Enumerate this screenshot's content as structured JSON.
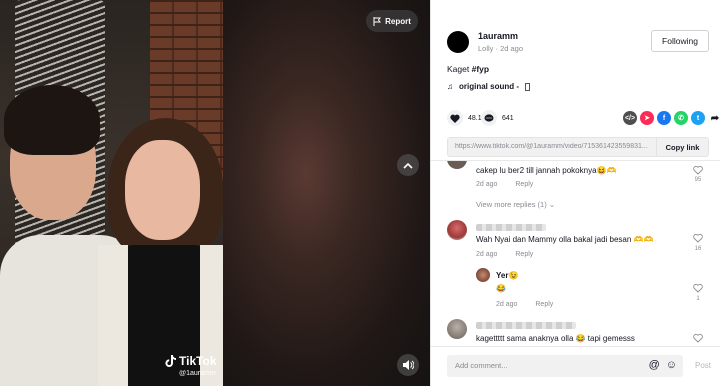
{
  "video": {
    "report_label": "Report",
    "watermark_brand": "TikTok",
    "watermark_handle": "@1auramm"
  },
  "author": {
    "username": "1auramm",
    "subline": "Lolly · 2d ago",
    "follow_label": "Following"
  },
  "caption": {
    "text": "Kaget",
    "hashtag": "#fyp"
  },
  "sound": {
    "label": "original sound - "
  },
  "actions": {
    "likes": "48.1K",
    "comments": "641"
  },
  "share_icons": [
    "embed-icon",
    "send-icon",
    "facebook-icon",
    "whatsapp-icon",
    "twitter-icon",
    "share-arrow-icon"
  ],
  "link": {
    "url": "https://www.tiktok.com/@1auramm/video/715361423559831...",
    "copy_label": "Copy link"
  },
  "comments": [
    {
      "text": "cakep lu ber2 till jannah pokoknya😆🫶",
      "time": "2d ago",
      "reply": "Reply",
      "likes": "95"
    },
    {
      "view_more": "View more replies (1)"
    },
    {
      "text": "Wah Nyai dan Mammy olla bakal jadi besan 🫶🫶",
      "time": "2d ago",
      "reply": "Reply",
      "likes": "16"
    },
    {
      "name": "Yer😉",
      "text": "😂",
      "time": "2d ago",
      "reply": "Reply",
      "likes": "1"
    },
    {
      "text": "kagettttt sama anaknya olla 😂  tapi gemesss",
      "likes": "0"
    }
  ],
  "footer": {
    "placeholder": "Add comment...",
    "post_label": "Post"
  },
  "colors": {
    "text": "#161823",
    "muted": "#8a8b91",
    "embed": "#4f4f4f",
    "send": "#fe2c55",
    "facebook": "#1877f2",
    "whatsapp": "#25d366",
    "twitter": "#1da1f2"
  }
}
